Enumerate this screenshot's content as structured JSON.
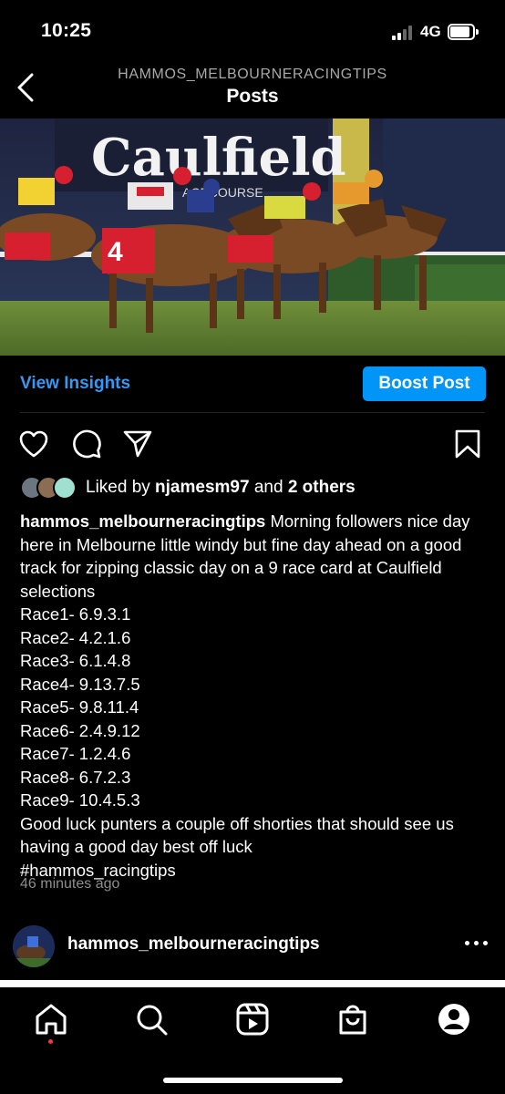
{
  "status_bar": {
    "time": "10:25",
    "network": "4G"
  },
  "header": {
    "account": "HAMMOS_MELBOURNERACINGTIPS",
    "title": "Posts"
  },
  "photo": {
    "sign_text": "Caulfield",
    "sign_subtext": "ACECOURSE",
    "saddle_cloth": "4"
  },
  "post": {
    "insights_label": "View Insights",
    "boost_label": "Boost Post",
    "liked_by_prefix": "Liked by ",
    "liked_by_user": "njamesm97",
    "liked_by_mid": " and ",
    "liked_by_others": "2 others",
    "caption_user": "hammos_melbourneracingtips",
    "caption_intro": " Morning followers nice day here in Melbourne little windy but fine day ahead on a good track for zipping classic day on a 9 race card at Caulfield selections",
    "races": [
      "Race1- 6.9.3.1",
      "Race2- 4.2.1.6",
      "Race3- 6.1.4.8",
      "Race4- 9.13.7.5",
      "Race5- 9.8.11.4",
      "Race6- 2.4.9.12",
      "Race7- 1.2.4.6",
      "Race8- 6.7.2.3",
      "Race9- 10.4.5.3"
    ],
    "caption_outro": "Good luck punters a couple off shorties that should see us having a good day best off luck",
    "hashtag": "#hammos_racingtips",
    "time_ago": "46 minutes ago"
  },
  "next_post": {
    "username": "hammos_melbourneracingtips"
  },
  "icons": {
    "back": "chevron-left-icon",
    "like": "heart-icon",
    "comment": "comment-icon",
    "share": "send-icon",
    "save": "bookmark-icon",
    "more": "more-horizontal-icon",
    "nav": [
      "home-icon",
      "search-icon",
      "reels-icon",
      "shop-icon",
      "profile-icon"
    ]
  },
  "colors": {
    "accent": "#0095f6",
    "link": "#3897f0",
    "background": "#000000",
    "notification_dot": "#ff3040"
  }
}
